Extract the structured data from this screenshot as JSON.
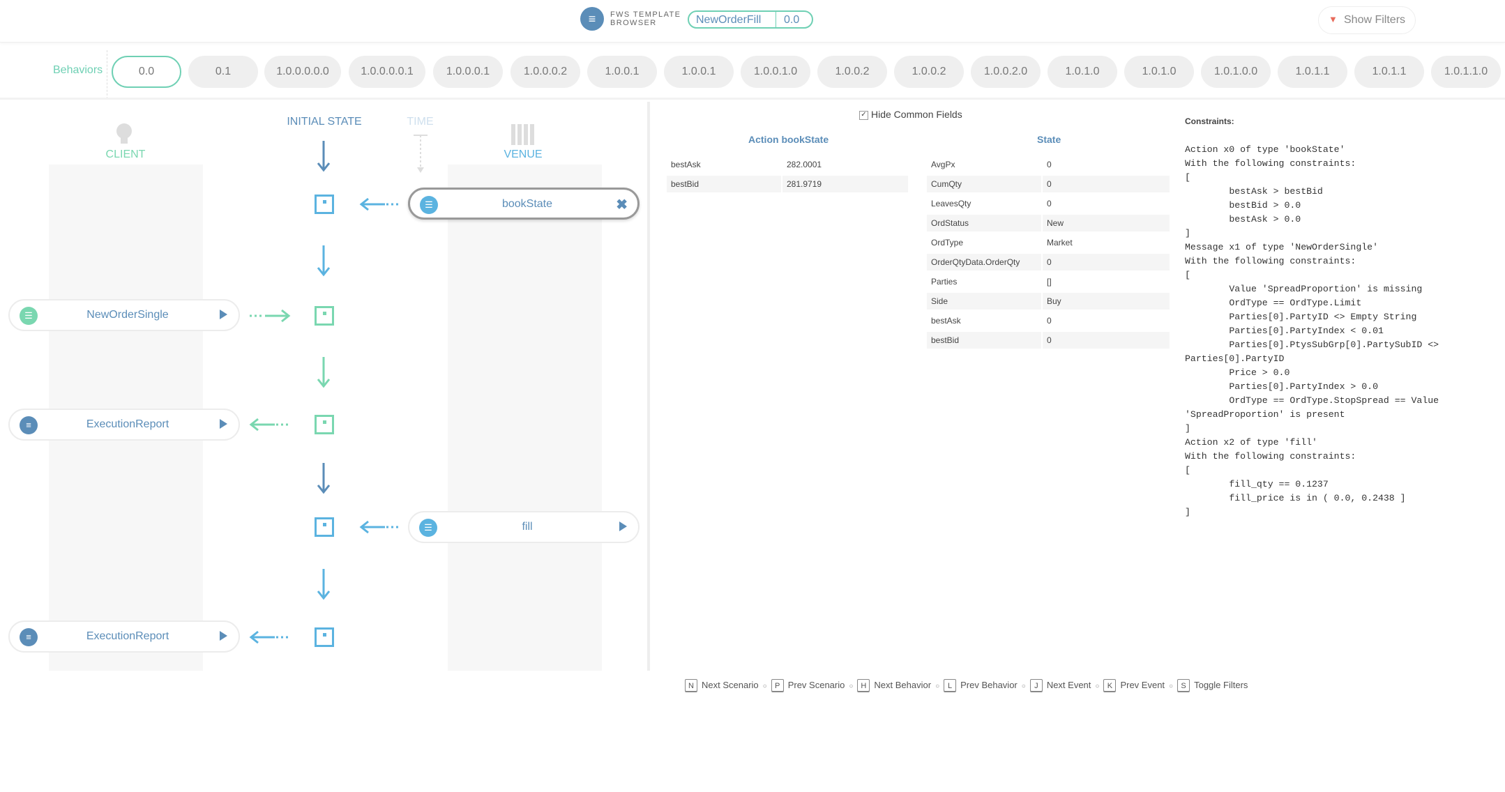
{
  "header": {
    "logo_text_1": "FWS TEMPLATE",
    "logo_text_2": "BROWSER",
    "template_name": "NewOrderFill",
    "template_version": "0.0",
    "show_filters": "Show Filters"
  },
  "behaviors": {
    "label": "Behaviors",
    "items": [
      "0.0",
      "0.1",
      "1.0.0.0.0.0",
      "1.0.0.0.0.1",
      "1.0.0.0.1",
      "1.0.0.0.2",
      "1.0.0.1",
      "1.0.0.1",
      "1.0.0.1.0",
      "1.0.0.2",
      "1.0.0.2",
      "1.0.0.2.0",
      "1.0.1.0",
      "1.0.1.0",
      "1.0.1.0.0",
      "1.0.1.1",
      "1.0.1.1",
      "1.0.1.1.0"
    ],
    "active_index": 0
  },
  "lanes": {
    "client": "CLIENT",
    "initial_state": "INITIAL STATE",
    "time": "TIME",
    "venue": "VENUE"
  },
  "events": [
    {
      "name": "bookState",
      "side": "venue",
      "icon": "sliders-icon",
      "color": "#5bb3e0",
      "selected": true
    },
    {
      "name": "NewOrderSingle",
      "side": "client",
      "icon": "sliders-icon",
      "color": "#7ad7b0"
    },
    {
      "name": "ExecutionReport",
      "side": "client",
      "icon": "list-icon",
      "color": "#5b8db8"
    },
    {
      "name": "fill",
      "side": "venue",
      "icon": "sliders-icon",
      "color": "#5bb3e0"
    },
    {
      "name": "ExecutionReport",
      "side": "client",
      "icon": "list-icon",
      "color": "#5b8db8"
    }
  ],
  "details": {
    "hide_common": "Hide Common Fields",
    "action_title": "Action bookState",
    "action_fields": [
      {
        "k": "bestAsk",
        "v": "282.0001"
      },
      {
        "k": "bestBid",
        "v": "281.9719"
      }
    ],
    "state_title": "State",
    "state_fields": [
      {
        "k": "AvgPx",
        "v": "0"
      },
      {
        "k": "CumQty",
        "v": "0"
      },
      {
        "k": "LeavesQty",
        "v": "0"
      },
      {
        "k": "OrdStatus",
        "v": "New"
      },
      {
        "k": "OrdType",
        "v": "Market"
      },
      {
        "k": "OrderQtyData.OrderQty",
        "v": "0"
      },
      {
        "k": "Parties",
        "v": "[]"
      },
      {
        "k": "Side",
        "v": "Buy"
      },
      {
        "k": "bestAsk",
        "v": "0"
      },
      {
        "k": "bestBid",
        "v": "0"
      }
    ]
  },
  "constraints": {
    "title": "Constraints:",
    "text": "Action x0 of type 'bookState'\nWith the following constraints:\n[\n        bestAsk > bestBid\n        bestBid > 0.0\n        bestAsk > 0.0\n]\nMessage x1 of type 'NewOrderSingle'\nWith the following constraints:\n[\n        Value 'SpreadProportion' is missing\n        OrdType == OrdType.Limit\n        Parties[0].PartyID <> Empty String\n        Parties[0].PartyIndex < 0.01\n        Parties[0].PtysSubGrp[0].PartySubID <> Parties[0].PartyID\n        Price > 0.0\n        Parties[0].PartyIndex > 0.0\n        OrdType == OrdType.StopSpread == Value 'SpreadProportion' is present\n]\nAction x2 of type 'fill'\nWith the following constraints:\n[\n        fill_qty == 0.1237\n        fill_price is in ( 0.0, 0.2438 ]\n]"
  },
  "shortcuts": [
    {
      "key": "N",
      "label": "Next Scenario"
    },
    {
      "key": "P",
      "label": "Prev Scenario"
    },
    {
      "key": "H",
      "label": "Next Behavior"
    },
    {
      "key": "L",
      "label": "Prev Behavior"
    },
    {
      "key": "J",
      "label": "Next Event"
    },
    {
      "key": "K",
      "label": "Prev Event"
    },
    {
      "key": "S",
      "label": "Toggle Filters"
    }
  ]
}
